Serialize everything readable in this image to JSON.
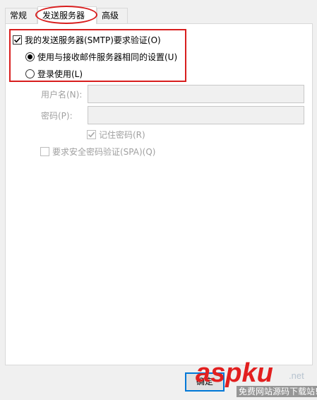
{
  "tabs": [
    {
      "label": "常规"
    },
    {
      "label": "发送服务器",
      "selected": true
    },
    {
      "label": "高级"
    }
  ],
  "auth": {
    "require_label": "我的发送服务器(SMTP)要求验证(O)",
    "require_checked": true,
    "same_settings_label": "使用与接收邮件服务器相同的设置(U)",
    "same_settings_selected": true,
    "login_label": "登录使用(L)",
    "login_selected": false
  },
  "credentials": {
    "username_label": "用户名(N):",
    "username_value": "",
    "password_label": "密码(P):",
    "password_value": "",
    "remember_label": "记住密码(R)",
    "remember_checked": true,
    "spa_label": "要求安全密码验证(SPA)(Q)",
    "spa_checked": false
  },
  "footer": {
    "button_label": "确定"
  },
  "watermark": {
    "main_asp": "asp",
    "main_ku": "ku",
    "net": ".net",
    "sub": "免费网站源码下载站!"
  },
  "colors": {
    "highlight": "#d81e1e",
    "focus": "#0078d7",
    "disabled_text": "#a0a0a0"
  }
}
